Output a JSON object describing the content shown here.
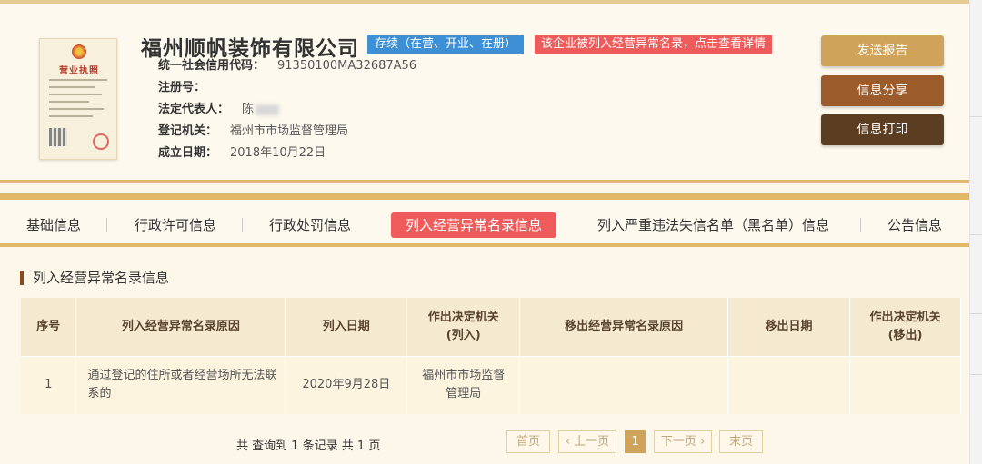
{
  "company": {
    "name": "福州顺帆装饰有限公司",
    "status_badge": "存续（在营、开业、在册）",
    "abnormal_notice": "该企业被列入经营异常名录，点击查看详情",
    "license_title": "营业执照",
    "fields": [
      {
        "label": "统一社会信用代码：",
        "value": "91350100MA32687A56"
      },
      {
        "label": "注册号：",
        "value": ""
      },
      {
        "label": "法定代表人：",
        "value": "陈"
      },
      {
        "label": "登记机关：",
        "value": "福州市市场监督管理局"
      },
      {
        "label": "成立日期：",
        "value": "2018年10月22日"
      }
    ]
  },
  "actions": {
    "send_report": "发送报告",
    "share_info": "信息分享",
    "print_info": "信息打印"
  },
  "tabs": [
    {
      "label": "基础信息",
      "active": false
    },
    {
      "label": "行政许可信息",
      "active": false
    },
    {
      "label": "行政处罚信息",
      "active": false
    },
    {
      "label": "列入经营异常名录信息",
      "active": true
    },
    {
      "label": "列入严重违法失信名单（黑名单）信息",
      "active": false
    },
    {
      "label": "公告信息",
      "active": false
    }
  ],
  "section": {
    "title": "列入经营异常名录信息",
    "table": {
      "headers": [
        "序号",
        "列入经营异常名录原因",
        "列入日期",
        "作出决定机关\n(列入)",
        "移出经营异常名录原因",
        "移出日期",
        "作出决定机关\n(移出)"
      ],
      "rows": [
        [
          "1",
          "通过登记的住所或者经营场所无法联系的",
          "2020年9月28日",
          "福州市市场监督管理局",
          "",
          "",
          ""
        ]
      ]
    }
  },
  "pagination": {
    "summary": "共 查询到 1 条记录 共 1 页",
    "first": "首页",
    "prev": "上一页",
    "current": "1",
    "next": "下一页",
    "last": "末页"
  },
  "colors": {
    "accent_gold": "#cfa35a",
    "share_brown": "#9c5b2a",
    "print_brown": "#5b3d22",
    "status_blue": "#3d8fd6",
    "alert_red": "#ef5b5b"
  }
}
